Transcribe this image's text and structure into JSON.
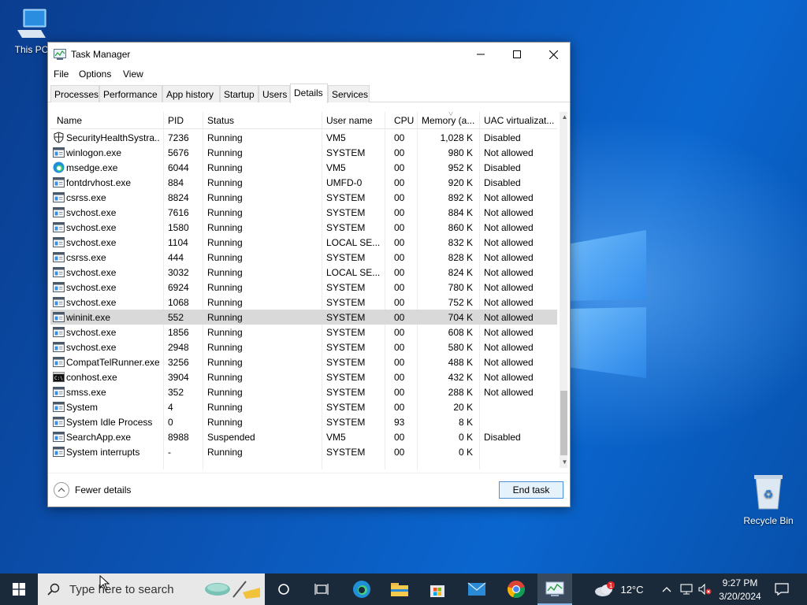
{
  "desktop": {
    "icons": [
      {
        "label": "This PC"
      },
      {
        "label": "Recycle Bin"
      }
    ]
  },
  "window": {
    "title": "Task Manager",
    "menu": [
      "File",
      "Options",
      "View"
    ],
    "tabs": [
      "Processes",
      "Performance",
      "App history",
      "Startup",
      "Users",
      "Details",
      "Services"
    ],
    "active_tab": "Details",
    "columns": [
      "Name",
      "PID",
      "Status",
      "User name",
      "CPU",
      "Memory (a...",
      "UAC virtualizat..."
    ],
    "rows": [
      {
        "icon": "shield-icon",
        "name": "SecurityHealthSystra...",
        "pid": "7236",
        "status": "Running",
        "user": "VM5",
        "cpu": "00",
        "mem": "1,028 K",
        "uac": "Disabled"
      },
      {
        "icon": "exe-icon",
        "name": "winlogon.exe",
        "pid": "5676",
        "status": "Running",
        "user": "SYSTEM",
        "cpu": "00",
        "mem": "980 K",
        "uac": "Not allowed"
      },
      {
        "icon": "edge-icon",
        "name": "msedge.exe",
        "pid": "6044",
        "status": "Running",
        "user": "VM5",
        "cpu": "00",
        "mem": "952 K",
        "uac": "Disabled"
      },
      {
        "icon": "exe-icon",
        "name": "fontdrvhost.exe",
        "pid": "884",
        "status": "Running",
        "user": "UMFD-0",
        "cpu": "00",
        "mem": "920 K",
        "uac": "Disabled"
      },
      {
        "icon": "exe-icon",
        "name": "csrss.exe",
        "pid": "8824",
        "status": "Running",
        "user": "SYSTEM",
        "cpu": "00",
        "mem": "892 K",
        "uac": "Not allowed"
      },
      {
        "icon": "exe-icon",
        "name": "svchost.exe",
        "pid": "7616",
        "status": "Running",
        "user": "SYSTEM",
        "cpu": "00",
        "mem": "884 K",
        "uac": "Not allowed"
      },
      {
        "icon": "exe-icon",
        "name": "svchost.exe",
        "pid": "1580",
        "status": "Running",
        "user": "SYSTEM",
        "cpu": "00",
        "mem": "860 K",
        "uac": "Not allowed"
      },
      {
        "icon": "exe-icon",
        "name": "svchost.exe",
        "pid": "1104",
        "status": "Running",
        "user": "LOCAL SE...",
        "cpu": "00",
        "mem": "832 K",
        "uac": "Not allowed"
      },
      {
        "icon": "exe-icon",
        "name": "csrss.exe",
        "pid": "444",
        "status": "Running",
        "user": "SYSTEM",
        "cpu": "00",
        "mem": "828 K",
        "uac": "Not allowed"
      },
      {
        "icon": "exe-icon",
        "name": "svchost.exe",
        "pid": "3032",
        "status": "Running",
        "user": "LOCAL SE...",
        "cpu": "00",
        "mem": "824 K",
        "uac": "Not allowed"
      },
      {
        "icon": "exe-icon",
        "name": "svchost.exe",
        "pid": "6924",
        "status": "Running",
        "user": "SYSTEM",
        "cpu": "00",
        "mem": "780 K",
        "uac": "Not allowed"
      },
      {
        "icon": "exe-icon",
        "name": "svchost.exe",
        "pid": "1068",
        "status": "Running",
        "user": "SYSTEM",
        "cpu": "00",
        "mem": "752 K",
        "uac": "Not allowed"
      },
      {
        "icon": "exe-icon",
        "name": "wininit.exe",
        "pid": "552",
        "status": "Running",
        "user": "SYSTEM",
        "cpu": "00",
        "mem": "704 K",
        "uac": "Not allowed",
        "selected": true
      },
      {
        "icon": "exe-icon",
        "name": "svchost.exe",
        "pid": "1856",
        "status": "Running",
        "user": "SYSTEM",
        "cpu": "00",
        "mem": "608 K",
        "uac": "Not allowed"
      },
      {
        "icon": "exe-icon",
        "name": "svchost.exe",
        "pid": "2948",
        "status": "Running",
        "user": "SYSTEM",
        "cpu": "00",
        "mem": "580 K",
        "uac": "Not allowed"
      },
      {
        "icon": "exe-icon",
        "name": "CompatTelRunner.exe",
        "pid": "3256",
        "status": "Running",
        "user": "SYSTEM",
        "cpu": "00",
        "mem": "488 K",
        "uac": "Not allowed"
      },
      {
        "icon": "console-icon",
        "name": "conhost.exe",
        "pid": "3904",
        "status": "Running",
        "user": "SYSTEM",
        "cpu": "00",
        "mem": "432 K",
        "uac": "Not allowed"
      },
      {
        "icon": "exe-icon",
        "name": "smss.exe",
        "pid": "352",
        "status": "Running",
        "user": "SYSTEM",
        "cpu": "00",
        "mem": "288 K",
        "uac": "Not allowed"
      },
      {
        "icon": "exe-icon",
        "name": "System",
        "pid": "4",
        "status": "Running",
        "user": "SYSTEM",
        "cpu": "00",
        "mem": "20 K",
        "uac": ""
      },
      {
        "icon": "exe-icon",
        "name": "System Idle Process",
        "pid": "0",
        "status": "Running",
        "user": "SYSTEM",
        "cpu": "93",
        "mem": "8 K",
        "uac": ""
      },
      {
        "icon": "exe-icon",
        "name": "SearchApp.exe",
        "pid": "8988",
        "status": "Suspended",
        "user": "VM5",
        "cpu": "00",
        "mem": "0 K",
        "uac": "Disabled"
      },
      {
        "icon": "exe-icon",
        "name": "System interrupts",
        "pid": "-",
        "status": "Running",
        "user": "SYSTEM",
        "cpu": "00",
        "mem": "0 K",
        "uac": ""
      }
    ],
    "footer": {
      "fewer_details": "Fewer details",
      "end_task": "End task"
    }
  },
  "taskbar": {
    "search_placeholder": "Type here to search",
    "weather_temp": "12°C",
    "weather_badge": "1",
    "time": "9:27 PM",
    "date": "3/20/2024"
  },
  "colors": {
    "selected_row": "#d9d9d9",
    "end_task_border": "#4a90d9",
    "taskbar": "#1b2a3a"
  }
}
